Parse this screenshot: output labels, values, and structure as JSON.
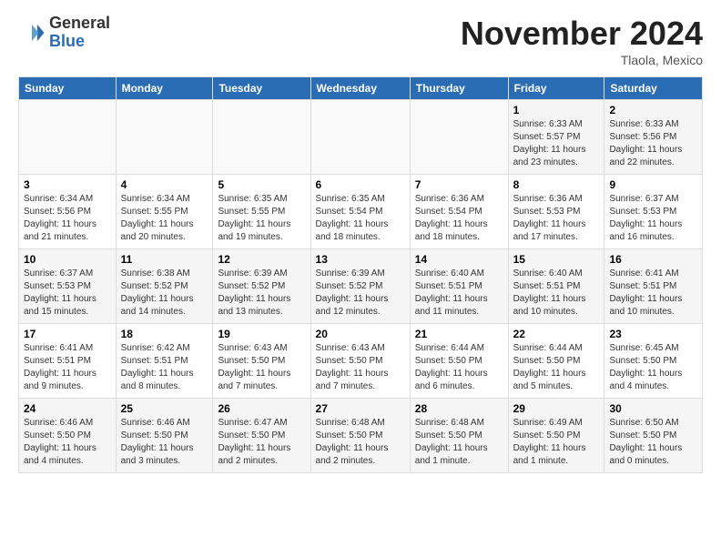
{
  "header": {
    "logo_general": "General",
    "logo_blue": "Blue",
    "month_title": "November 2024",
    "location": "Tlaola, Mexico"
  },
  "days_of_week": [
    "Sunday",
    "Monday",
    "Tuesday",
    "Wednesday",
    "Thursday",
    "Friday",
    "Saturday"
  ],
  "weeks": [
    [
      {
        "day": "",
        "info": ""
      },
      {
        "day": "",
        "info": ""
      },
      {
        "day": "",
        "info": ""
      },
      {
        "day": "",
        "info": ""
      },
      {
        "day": "",
        "info": ""
      },
      {
        "day": "1",
        "info": "Sunrise: 6:33 AM\nSunset: 5:57 PM\nDaylight: 11 hours and 23 minutes."
      },
      {
        "day": "2",
        "info": "Sunrise: 6:33 AM\nSunset: 5:56 PM\nDaylight: 11 hours and 22 minutes."
      }
    ],
    [
      {
        "day": "3",
        "info": "Sunrise: 6:34 AM\nSunset: 5:56 PM\nDaylight: 11 hours and 21 minutes."
      },
      {
        "day": "4",
        "info": "Sunrise: 6:34 AM\nSunset: 5:55 PM\nDaylight: 11 hours and 20 minutes."
      },
      {
        "day": "5",
        "info": "Sunrise: 6:35 AM\nSunset: 5:55 PM\nDaylight: 11 hours and 19 minutes."
      },
      {
        "day": "6",
        "info": "Sunrise: 6:35 AM\nSunset: 5:54 PM\nDaylight: 11 hours and 18 minutes."
      },
      {
        "day": "7",
        "info": "Sunrise: 6:36 AM\nSunset: 5:54 PM\nDaylight: 11 hours and 18 minutes."
      },
      {
        "day": "8",
        "info": "Sunrise: 6:36 AM\nSunset: 5:53 PM\nDaylight: 11 hours and 17 minutes."
      },
      {
        "day": "9",
        "info": "Sunrise: 6:37 AM\nSunset: 5:53 PM\nDaylight: 11 hours and 16 minutes."
      }
    ],
    [
      {
        "day": "10",
        "info": "Sunrise: 6:37 AM\nSunset: 5:53 PM\nDaylight: 11 hours and 15 minutes."
      },
      {
        "day": "11",
        "info": "Sunrise: 6:38 AM\nSunset: 5:52 PM\nDaylight: 11 hours and 14 minutes."
      },
      {
        "day": "12",
        "info": "Sunrise: 6:39 AM\nSunset: 5:52 PM\nDaylight: 11 hours and 13 minutes."
      },
      {
        "day": "13",
        "info": "Sunrise: 6:39 AM\nSunset: 5:52 PM\nDaylight: 11 hours and 12 minutes."
      },
      {
        "day": "14",
        "info": "Sunrise: 6:40 AM\nSunset: 5:51 PM\nDaylight: 11 hours and 11 minutes."
      },
      {
        "day": "15",
        "info": "Sunrise: 6:40 AM\nSunset: 5:51 PM\nDaylight: 11 hours and 10 minutes."
      },
      {
        "day": "16",
        "info": "Sunrise: 6:41 AM\nSunset: 5:51 PM\nDaylight: 11 hours and 10 minutes."
      }
    ],
    [
      {
        "day": "17",
        "info": "Sunrise: 6:41 AM\nSunset: 5:51 PM\nDaylight: 11 hours and 9 minutes."
      },
      {
        "day": "18",
        "info": "Sunrise: 6:42 AM\nSunset: 5:51 PM\nDaylight: 11 hours and 8 minutes."
      },
      {
        "day": "19",
        "info": "Sunrise: 6:43 AM\nSunset: 5:50 PM\nDaylight: 11 hours and 7 minutes."
      },
      {
        "day": "20",
        "info": "Sunrise: 6:43 AM\nSunset: 5:50 PM\nDaylight: 11 hours and 7 minutes."
      },
      {
        "day": "21",
        "info": "Sunrise: 6:44 AM\nSunset: 5:50 PM\nDaylight: 11 hours and 6 minutes."
      },
      {
        "day": "22",
        "info": "Sunrise: 6:44 AM\nSunset: 5:50 PM\nDaylight: 11 hours and 5 minutes."
      },
      {
        "day": "23",
        "info": "Sunrise: 6:45 AM\nSunset: 5:50 PM\nDaylight: 11 hours and 4 minutes."
      }
    ],
    [
      {
        "day": "24",
        "info": "Sunrise: 6:46 AM\nSunset: 5:50 PM\nDaylight: 11 hours and 4 minutes."
      },
      {
        "day": "25",
        "info": "Sunrise: 6:46 AM\nSunset: 5:50 PM\nDaylight: 11 hours and 3 minutes."
      },
      {
        "day": "26",
        "info": "Sunrise: 6:47 AM\nSunset: 5:50 PM\nDaylight: 11 hours and 2 minutes."
      },
      {
        "day": "27",
        "info": "Sunrise: 6:48 AM\nSunset: 5:50 PM\nDaylight: 11 hours and 2 minutes."
      },
      {
        "day": "28",
        "info": "Sunrise: 6:48 AM\nSunset: 5:50 PM\nDaylight: 11 hours and 1 minute."
      },
      {
        "day": "29",
        "info": "Sunrise: 6:49 AM\nSunset: 5:50 PM\nDaylight: 11 hours and 1 minute."
      },
      {
        "day": "30",
        "info": "Sunrise: 6:50 AM\nSunset: 5:50 PM\nDaylight: 11 hours and 0 minutes."
      }
    ]
  ]
}
